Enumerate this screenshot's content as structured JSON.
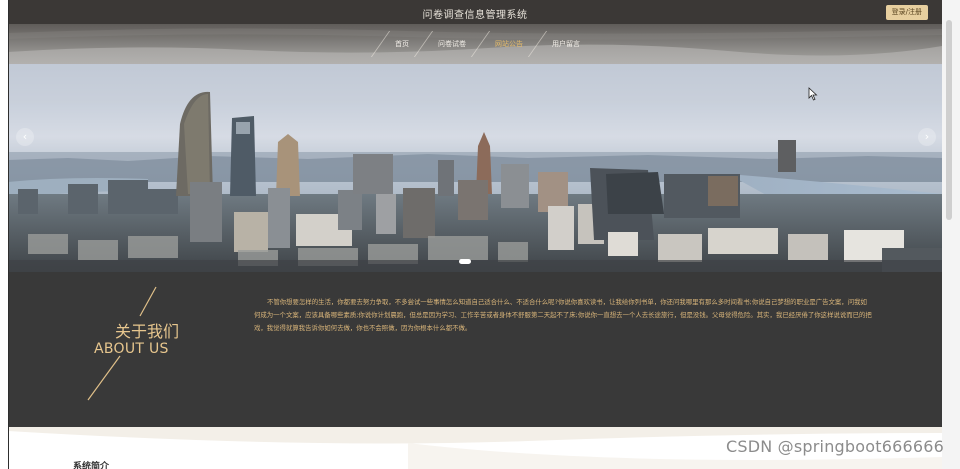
{
  "header": {
    "site_title": "问卷调查信息管理系统",
    "login_label": "登录/注册"
  },
  "nav": {
    "items": [
      {
        "label": "首页",
        "active": false
      },
      {
        "label": "问卷试卷",
        "active": false
      },
      {
        "label": "网站公告",
        "active": true
      },
      {
        "label": "用户留言",
        "active": false
      }
    ]
  },
  "banner": {
    "prev_icon": "chevron-left-icon",
    "next_icon": "chevron-right-icon",
    "prev_glyph": "‹",
    "next_glyph": "›",
    "slide_count_shown": 1
  },
  "about": {
    "title_cn": "关于我们",
    "title_en": "ABOUT US",
    "text": "不管你想要怎样的生活，你都要去努力争取，不多尝试一些事情怎么知道自己适合什么、不适合什么呢?你说你喜欢读书，让我给你列书单，你还问我哪里有那么多时间看书;你说自己梦想的职业是广告文案，问我如何成为一个文案，应该具备哪些素质;你说你计划晨跑，但总是因为学习、工作辛苦或者身体不舒服第二天起不了床;你说你一直想去一个人去长途旅行，但是没钱。父母觉得危险。其实，我已经厌倦了你这样说说而已的把戏，我觉得就算我告诉你如何去做，你也不会照做，因为你根本什么都不做。"
  },
  "section": {
    "title": "系统简介"
  },
  "watermark": "CSDN @springboot666666",
  "colors": {
    "topbar": "#3b3836",
    "accent": "#e2b96a",
    "about_bg": "#393939",
    "about_text": "#d9b57a",
    "login_bg": "#e7cf9f"
  }
}
